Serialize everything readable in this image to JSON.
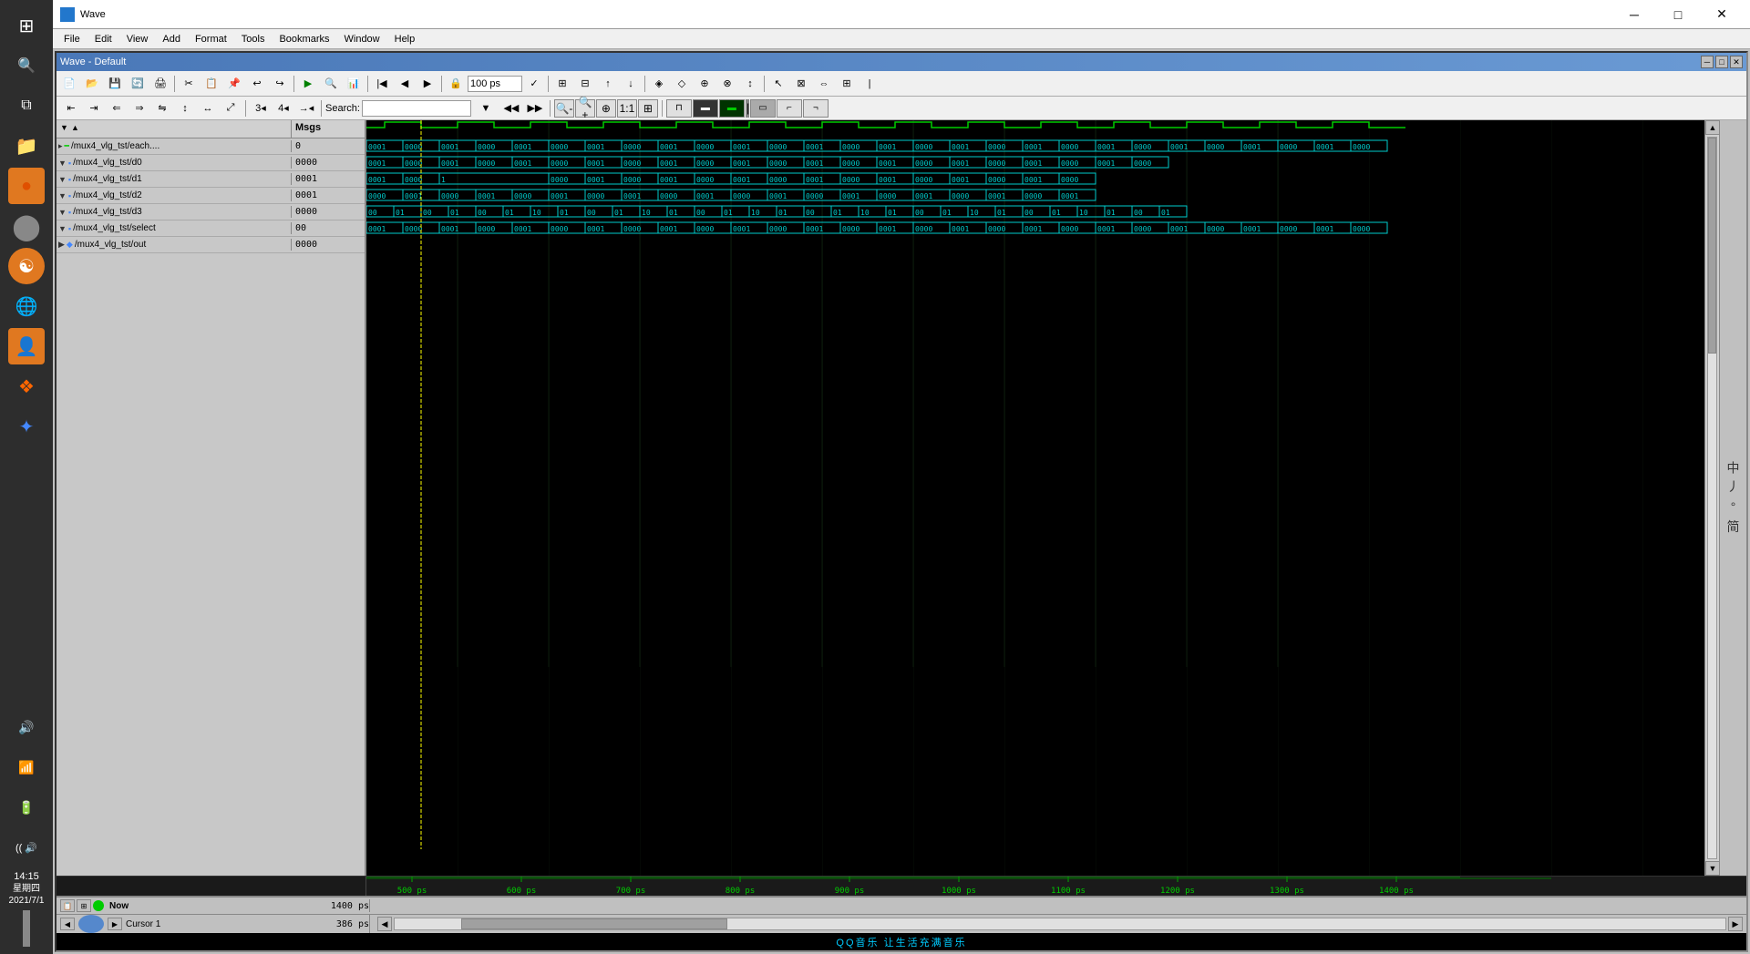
{
  "app": {
    "title": "Wave",
    "wave_window_title": "Wave - Default"
  },
  "title_bar": {
    "title": "Wave",
    "minimize": "─",
    "maximize": "□",
    "close": "✕"
  },
  "menu": {
    "items": [
      "File",
      "Edit",
      "View",
      "Add",
      "Format",
      "Tools",
      "Bookmarks",
      "Window",
      "Help"
    ]
  },
  "toolbars": {
    "zoom_value": "100 ps",
    "search_placeholder": "Search:",
    "search_label": "Search:"
  },
  "signals": [
    {
      "name": "/mux4_vlg_tst/each....",
      "value": "0",
      "type": "bit",
      "expanded": false
    },
    {
      "name": "/mux4_vlg_tst/d0",
      "value": "0000",
      "type": "bus",
      "expanded": true
    },
    {
      "name": "/mux4_vlg_tst/d1",
      "value": "0001",
      "type": "bus",
      "expanded": true
    },
    {
      "name": "/mux4_vlg_tst/d2",
      "value": "0001",
      "type": "bus",
      "expanded": true
    },
    {
      "name": "/mux4_vlg_tst/d3",
      "value": "0000",
      "type": "bus",
      "expanded": true
    },
    {
      "name": "/mux4_vlg_tst/select",
      "value": "00",
      "type": "bus",
      "expanded": true
    },
    {
      "name": "/mux4_vlg_tst/out",
      "value": "0000",
      "type": "bus",
      "expanded": true
    }
  ],
  "header_cols": {
    "name": "   ",
    "msgs": "Msgs"
  },
  "status": {
    "now": "Now",
    "now_value": "1400 ps",
    "cursor_label": "Cursor 1",
    "cursor_value": "386 ps"
  },
  "timeline": {
    "marks": [
      "500 ps",
      "600 ps",
      "700 ps",
      "800 ps",
      "900 ps",
      "1000 ps",
      "1100 ps",
      "1200 ps",
      "1300 ps",
      "1400 ps"
    ]
  },
  "left_sidebar": {
    "icons": [
      "🗂",
      "⚫",
      "🔵",
      "💛",
      "🔴",
      "🔵"
    ]
  },
  "right_panel": {
    "chars": [
      "中",
      "丿",
      "°",
      "简"
    ]
  },
  "taskbar_bottom": {
    "time": "14:15",
    "date": "星期四\n2021/7/1",
    "icons": [
      "🔊",
      "📶",
      "🔋"
    ]
  },
  "app_icons": [
    {
      "name": "windows",
      "symbol": "⊞",
      "color": "#ffffff"
    },
    {
      "name": "search",
      "symbol": "🔍",
      "color": "#ffffff"
    },
    {
      "name": "taskview",
      "symbol": "⧉",
      "color": "#ffffff"
    },
    {
      "name": "fileexplorer",
      "symbol": "📁",
      "color": "#e8a020"
    },
    {
      "name": "app1",
      "symbol": "⬤",
      "color": "#e07820"
    },
    {
      "name": "app2",
      "symbol": "⬤",
      "color": "#ffffff"
    },
    {
      "name": "app3",
      "symbol": "☯",
      "color": "#e07820"
    },
    {
      "name": "app4",
      "symbol": "🌐",
      "color": "#4488ff"
    },
    {
      "name": "app5",
      "symbol": "👤",
      "color": "#e07820"
    },
    {
      "name": "app6",
      "symbol": "❖",
      "color": "#ff6600"
    },
    {
      "name": "app7",
      "symbol": "✦",
      "color": "#4488ff"
    }
  ],
  "colors": {
    "waveform_bg": "#000000",
    "signal_green": "#00cc00",
    "signal_cyan": "#00cccc",
    "cursor_yellow": "#ffff00",
    "timeline_text": "#00ff00",
    "grid_line": "#1a3a1a"
  }
}
